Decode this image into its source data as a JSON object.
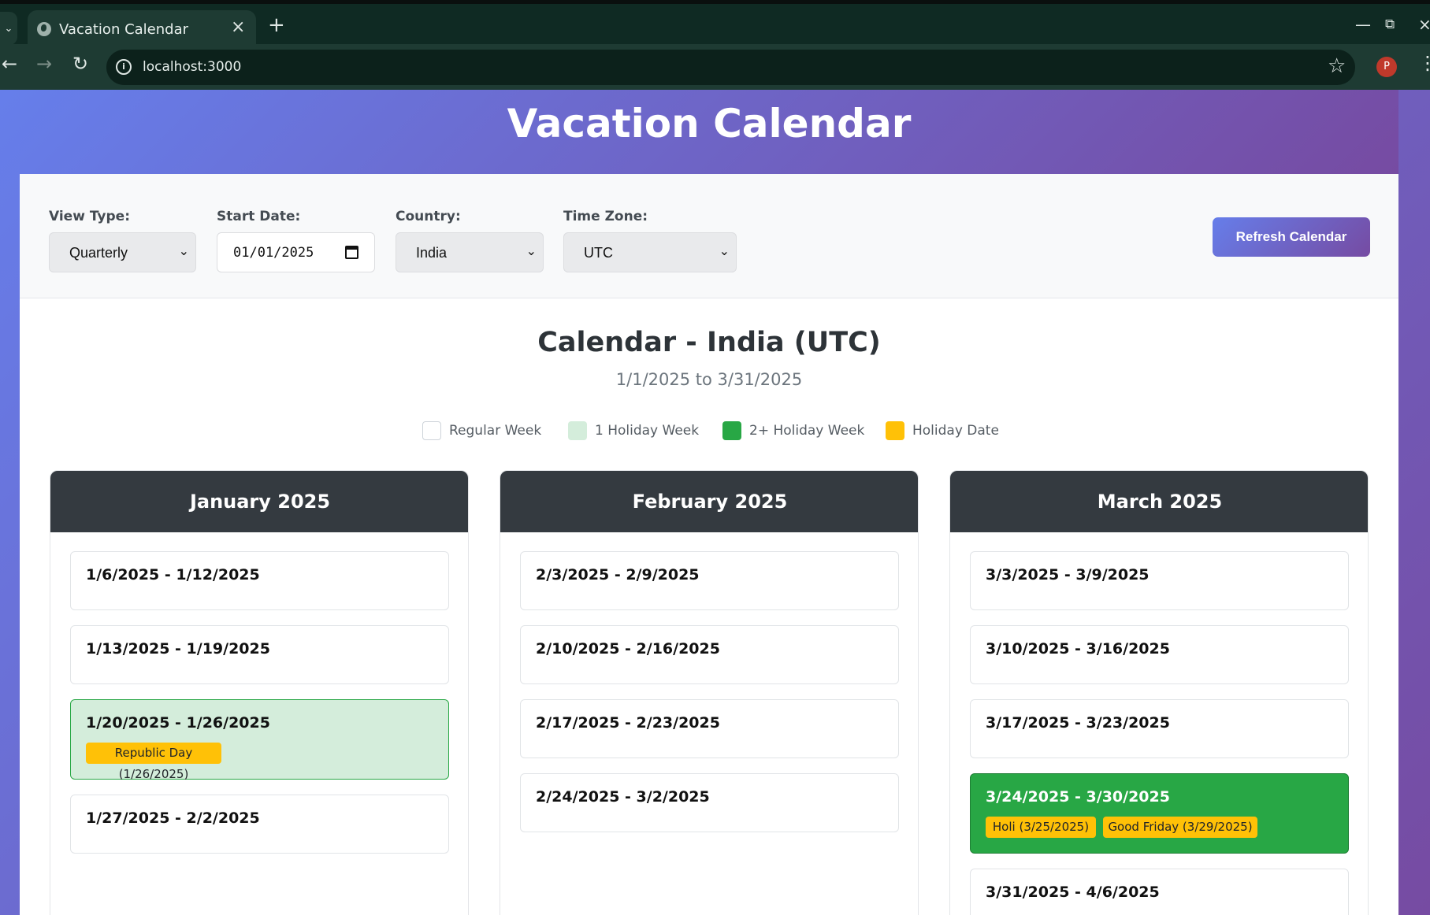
{
  "browser": {
    "tab_title": "Vacation Calendar",
    "url": "localhost:3000",
    "avatar_letter": "P",
    "icons": [
      "tab-list-icon",
      "globe-icon",
      "close-icon",
      "plus-icon",
      "minimize-icon",
      "restore-icon",
      "close-window-icon",
      "back-icon",
      "forward-icon",
      "reload-icon",
      "info-icon",
      "star-icon",
      "more-icon"
    ]
  },
  "app": {
    "title": "Vacation Calendar",
    "controls": {
      "view_type_label": "View Type:",
      "view_type_value": "Quarterly",
      "start_date_label": "Start Date:",
      "start_date_value": "01/01/2025",
      "country_label": "Country:",
      "country_value": "India",
      "timezone_label": "Time Zone:",
      "timezone_value": "UTC",
      "refresh_label": "Refresh Calendar"
    },
    "calendar_title": "Calendar - India (UTC)",
    "calendar_range": "1/1/2025 to 3/31/2025",
    "legend": [
      {
        "label": "Regular Week",
        "color": "#ffffff"
      },
      {
        "label": "1 Holiday Week",
        "color": "#d4eddb"
      },
      {
        "label": "2+ Holiday Week",
        "color": "#28a745"
      },
      {
        "label": "Holiday Date",
        "color": "#ffc107"
      }
    ],
    "months": [
      {
        "name": "January 2025",
        "weeks": [
          {
            "range": "1/6/2025 - 1/12/2025",
            "holidays": []
          },
          {
            "range": "1/13/2025 - 1/19/2025",
            "holidays": []
          },
          {
            "range": "1/20/2025 - 1/26/2025",
            "holidays": [
              "Republic Day (1/26/2025)"
            ]
          },
          {
            "range": "1/27/2025 - 2/2/2025",
            "holidays": []
          }
        ]
      },
      {
        "name": "February 2025",
        "weeks": [
          {
            "range": "2/3/2025 - 2/9/2025",
            "holidays": []
          },
          {
            "range": "2/10/2025 - 2/16/2025",
            "holidays": []
          },
          {
            "range": "2/17/2025 - 2/23/2025",
            "holidays": []
          },
          {
            "range": "2/24/2025 - 3/2/2025",
            "holidays": []
          }
        ]
      },
      {
        "name": "March 2025",
        "weeks": [
          {
            "range": "3/3/2025 - 3/9/2025",
            "holidays": []
          },
          {
            "range": "3/10/2025 - 3/16/2025",
            "holidays": []
          },
          {
            "range": "3/17/2025 - 3/23/2025",
            "holidays": []
          },
          {
            "range": "3/24/2025 - 3/30/2025",
            "holidays": [
              "Holi (3/25/2025)",
              "Good Friday (3/29/2025)"
            ]
          },
          {
            "range": "3/31/2025 - 4/6/2025",
            "holidays": []
          }
        ]
      }
    ]
  }
}
